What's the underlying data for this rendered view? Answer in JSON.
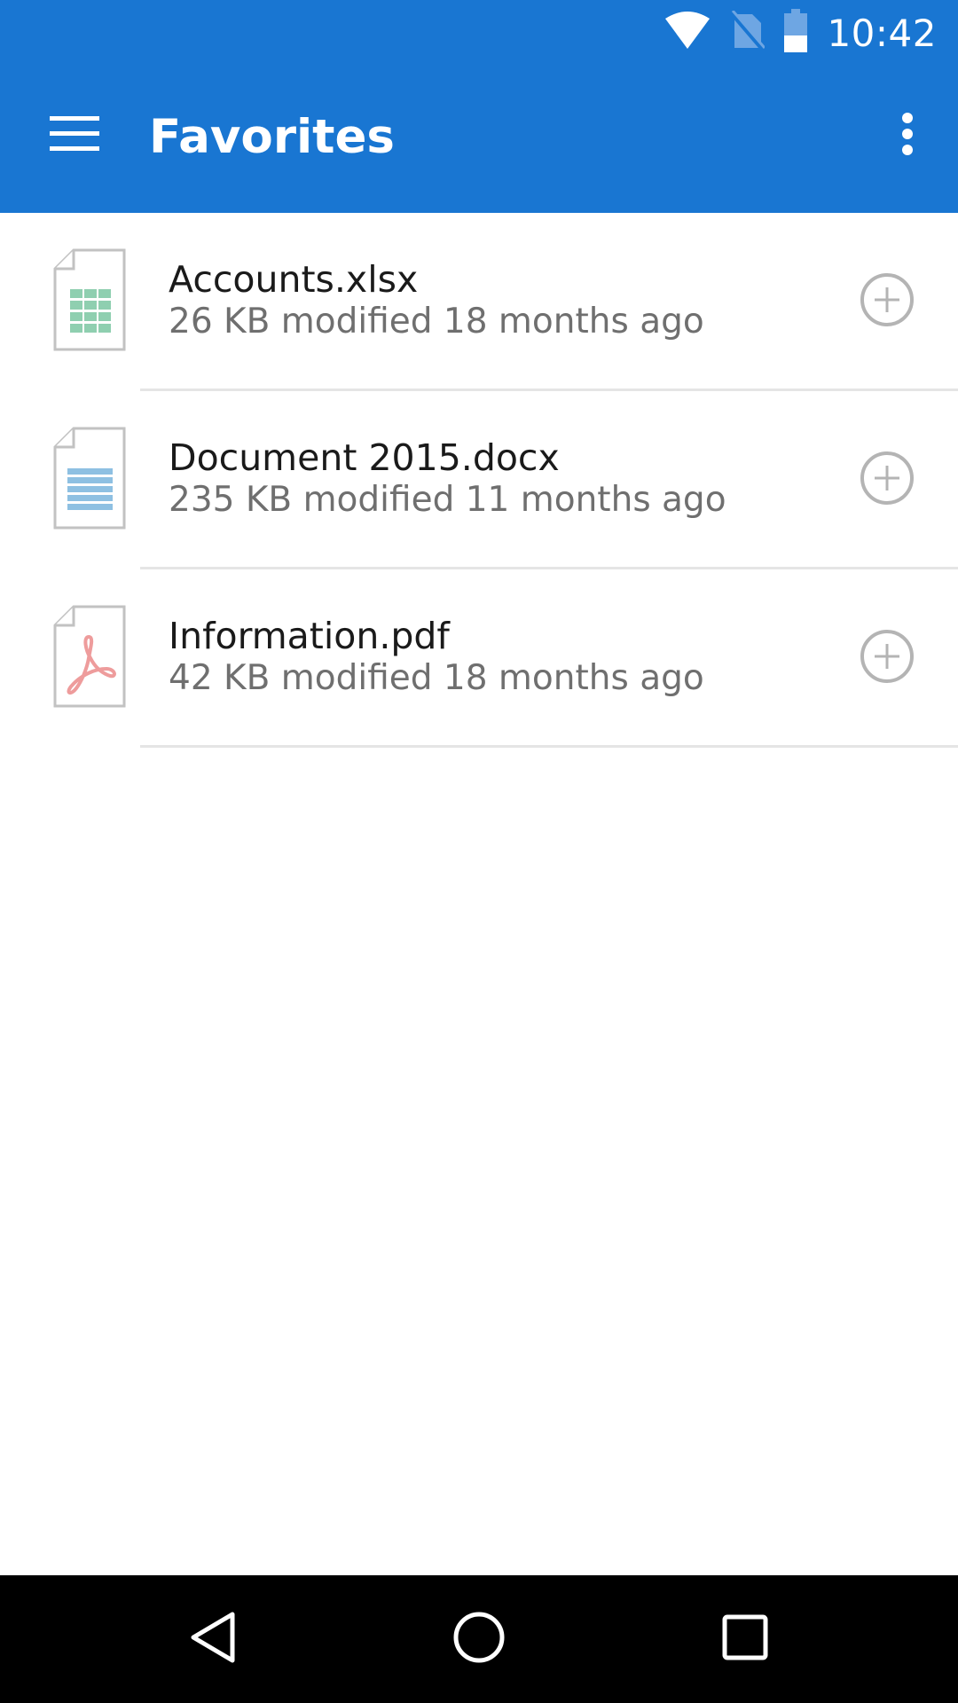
{
  "status_bar": {
    "time": "10:42",
    "icons": [
      "wifi-icon",
      "no-sim-icon",
      "battery-icon"
    ]
  },
  "app_bar": {
    "title": "Favorites",
    "menu_icon": "hamburger-menu-icon",
    "overflow_icon": "more-vert-icon",
    "background_color": "#1976d2"
  },
  "files": [
    {
      "name": "Accounts.xlsx",
      "meta": "26 KB modified 18 months ago",
      "type_icon": "spreadsheet-file-icon",
      "accent_color": "#8fcfb0",
      "action_icon": "add-circle-icon"
    },
    {
      "name": "Document 2015.docx",
      "meta": "235 KB modified 11 months ago",
      "type_icon": "document-file-icon",
      "accent_color": "#8ec0e2",
      "action_icon": "add-circle-icon"
    },
    {
      "name": "Information.pdf",
      "meta": "42 KB modified 18 months ago",
      "type_icon": "pdf-file-icon",
      "accent_color": "#ee9c9c",
      "action_icon": "add-circle-icon"
    }
  ],
  "nav_bar": {
    "back_icon": "back-icon",
    "home_icon": "home-icon",
    "recents_icon": "recents-icon"
  }
}
